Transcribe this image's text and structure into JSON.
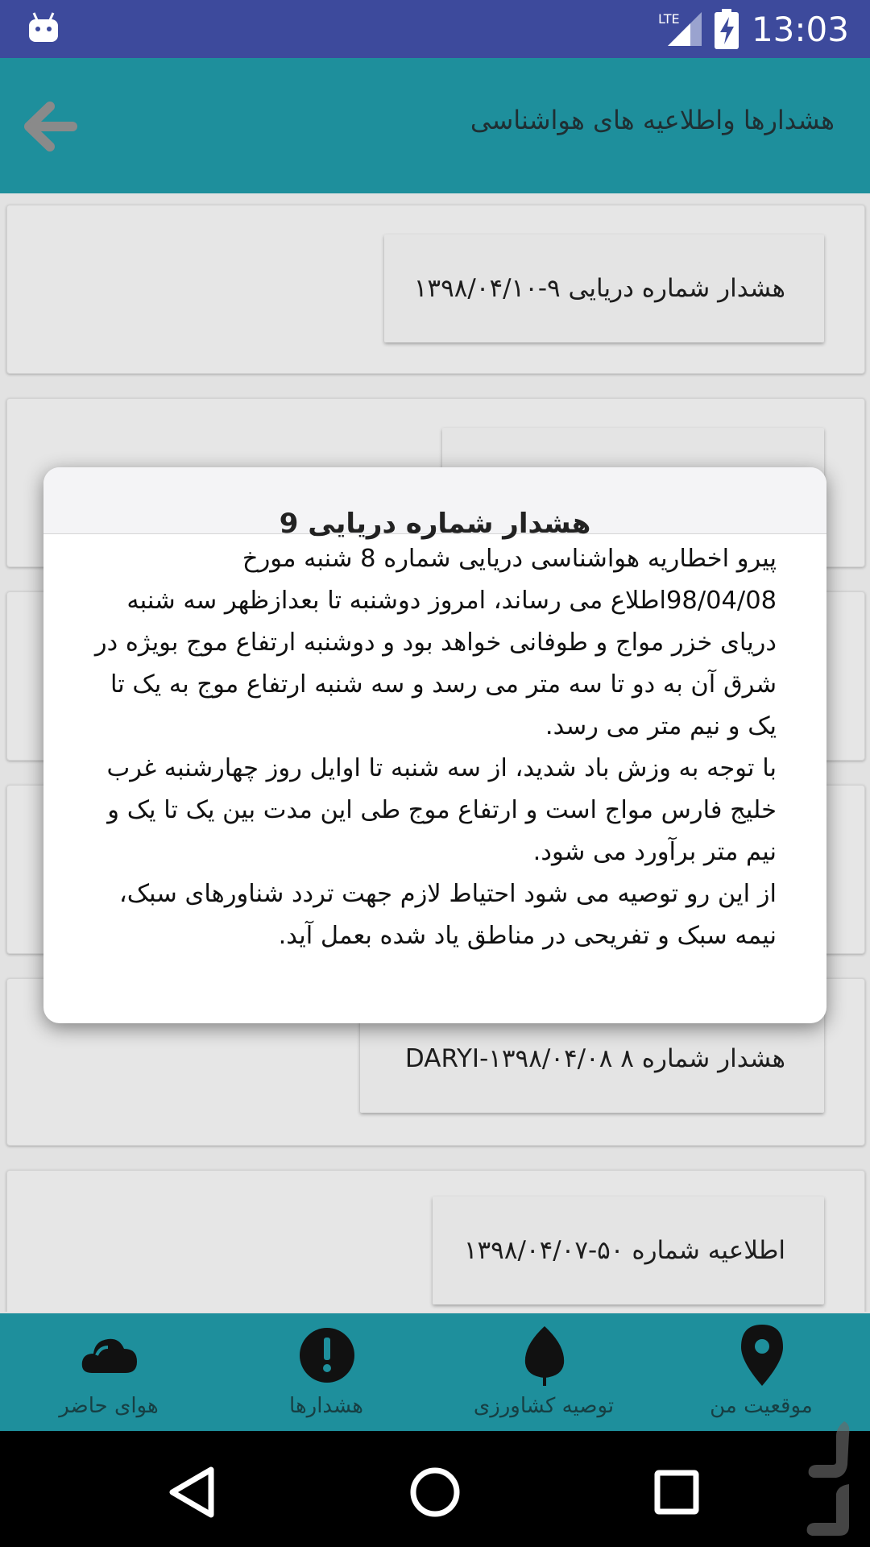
{
  "status_bar": {
    "time": "13:03",
    "network": "LTE",
    "icons": [
      "android-icon",
      "signal-icon",
      "battery-charging-icon"
    ]
  },
  "app_bar": {
    "title": "هشدارها واطلاعیه های هواشناسی",
    "back_icon": "arrow-left-icon"
  },
  "list": {
    "items": [
      {
        "title": "هشدار شماره دریایی ۹-۱۳۹۸/۰۴/۱۰"
      },
      {
        "title": ""
      },
      {
        "title": ""
      },
      {
        "title": ""
      },
      {
        "title": "هشدار شماره ۸ DARYI-۱۳۹۸/۰۴/۰۸"
      },
      {
        "title": "اطلاعیه شماره ۵۰-۱۳۹۸/۰۴/۰۷"
      }
    ]
  },
  "dialog": {
    "title": "هشدار شماره دریایی 9",
    "paragraphs": [
      "پیرو اخطاریه هواشناسی دریایی شماره 8 شنبه مورخ 98/04/08اطلاع می رساند، امروز دوشنبه تا بعدازظهر سه شنبه دریای خزر مواج و طوفانی خواهد بود و دوشنبه ارتفاع موج بویژه در شرق آن به دو تا سه متر می رسد و سه شنبه ارتفاع موج به یک تا یک و نیم متر می رسد.",
      "با توجه به وزش باد شدید، از سه شنبه تا اوایل روز چهارشنبه غرب خلیج فارس مواج است و ارتفاع موج طی این مدت بین یک تا یک و نیم متر برآورد می شود.",
      " از این رو توصیه می شود احتیاط لازم جهت تردد شناورهای سبک، نیمه سبک و تفریحی در مناطق یاد شده بعمل آید."
    ]
  },
  "bottom_nav": {
    "items": [
      {
        "label": "هوای حاضر",
        "icon": "cloud-icon"
      },
      {
        "label": "هشدارها",
        "icon": "alert-circle-icon"
      },
      {
        "label": "توصیه کشاورزی",
        "icon": "leaf-icon"
      },
      {
        "label": "موقعیت من",
        "icon": "location-pin-icon"
      }
    ]
  },
  "system_nav": {
    "icons": [
      "back-triangle-icon",
      "home-circle-icon",
      "recents-square-icon"
    ]
  },
  "colors": {
    "status_bar": "#3d4a9c",
    "app_bar": "#1e8f9c",
    "background": "#e2e2e2",
    "dialog": "#ffffff"
  }
}
